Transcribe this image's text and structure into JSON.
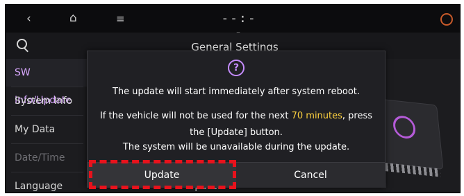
{
  "topbar": {
    "back_glyph": "‹",
    "home_glyph": "⌂",
    "menu_glyph": "≡",
    "clock": "--:--"
  },
  "header": {
    "title": "General Settings"
  },
  "sidebar": {
    "items": [
      {
        "label": "SW Info/Update"
      },
      {
        "label": "System Info"
      },
      {
        "label": "My Data"
      },
      {
        "label": "Date/Time"
      },
      {
        "label": "Language"
      }
    ]
  },
  "background": {
    "update_label": "Update"
  },
  "dialog": {
    "help_glyph": "?",
    "line1": "The update will start immediately after system reboot.",
    "line2_prefix": "If the vehicle will not be used for the next ",
    "line2_highlight": "70 minutes",
    "line2_suffix": ", press",
    "line3": "the [Update] button.",
    "line4": "The system will be unavailable during the update.",
    "update_button": "Update",
    "cancel_button": "Cancel"
  },
  "colors": {
    "highlight_text": "#ffd23f",
    "accent": "#c58cff",
    "annotation": "#e8121c"
  }
}
